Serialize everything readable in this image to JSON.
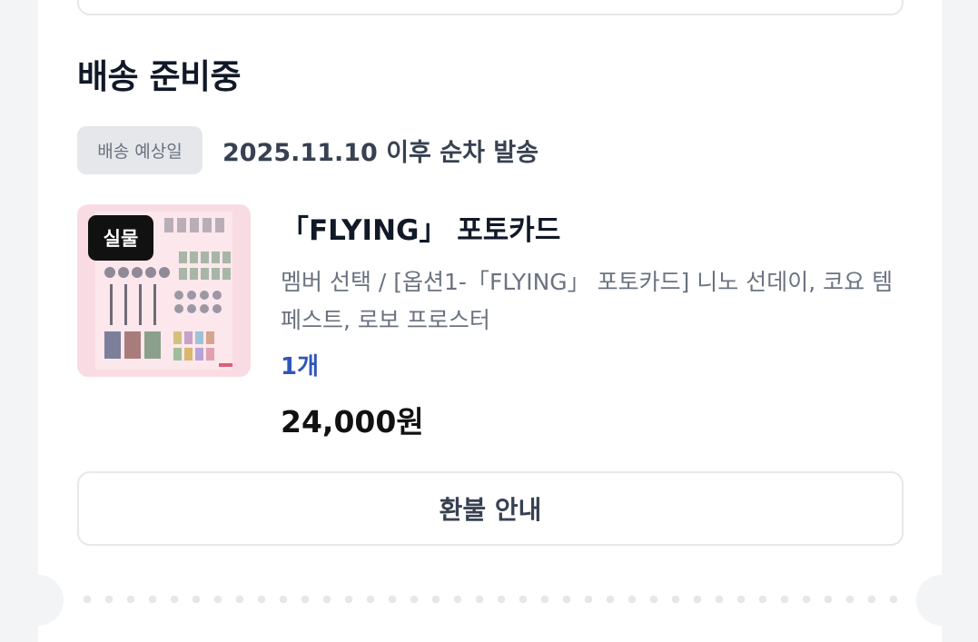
{
  "order": {
    "status_title": "배송 준비중",
    "shipping_badge": "배송 예상일",
    "shipping_date_text": "2025.11.10 이후 순차 발송"
  },
  "product": {
    "thumbnail_badge": "실물",
    "name": "「FLYING」 포토카드",
    "option": "멤버 선택 / [옵션1-「FLYING」 포토카드] 니노 선데이, 코요 템페스트, 로보 프로스터",
    "quantity": "1개",
    "price": "24,000원"
  },
  "actions": {
    "refund_label": "환불 안내"
  },
  "colors": {
    "accent_quantity": "#2f55b8",
    "badge_bg": "#e5e7eb",
    "thumb_bg": "#f9dce3"
  }
}
